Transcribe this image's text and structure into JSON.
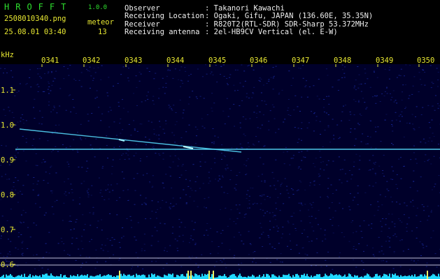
{
  "header": {
    "brand": "HROFFT",
    "version": "1.0.0",
    "filename": "2508010340.png",
    "datetime": "25.08.01 03:40",
    "meteor_label": "meteor",
    "meteor_count": "13",
    "info": [
      {
        "key": "Observer",
        "value": ": Takanori Kawachi"
      },
      {
        "key": "Receiving Location",
        "value": ": Ogaki, Gifu, JAPAN (136.60E, 35.35N)"
      },
      {
        "key": "Receiver",
        "value": ": R820T2(RTL-SDR) SDR-Sharp 53.372MHz"
      },
      {
        "key": "Receiving antenna",
        "value": ": 2el-HB9CV Vertical (el. E-W)"
      }
    ]
  },
  "plot": {
    "y_unit": "kHz",
    "time_ticks": [
      "0341",
      "0342",
      "0343",
      "0344",
      "0345",
      "0346",
      "0347",
      "0348",
      "0349",
      "0350"
    ],
    "freq_ticks": [
      "1.1",
      "1.0",
      "0.9",
      "0.8",
      "0.7",
      "0.6"
    ],
    "colors": {
      "background": "#00002a",
      "noise": "#1a2aa0",
      "trace": "#58e0ff",
      "axis_label": "#e8e832",
      "spectrum": "#20d8ff"
    }
  }
}
